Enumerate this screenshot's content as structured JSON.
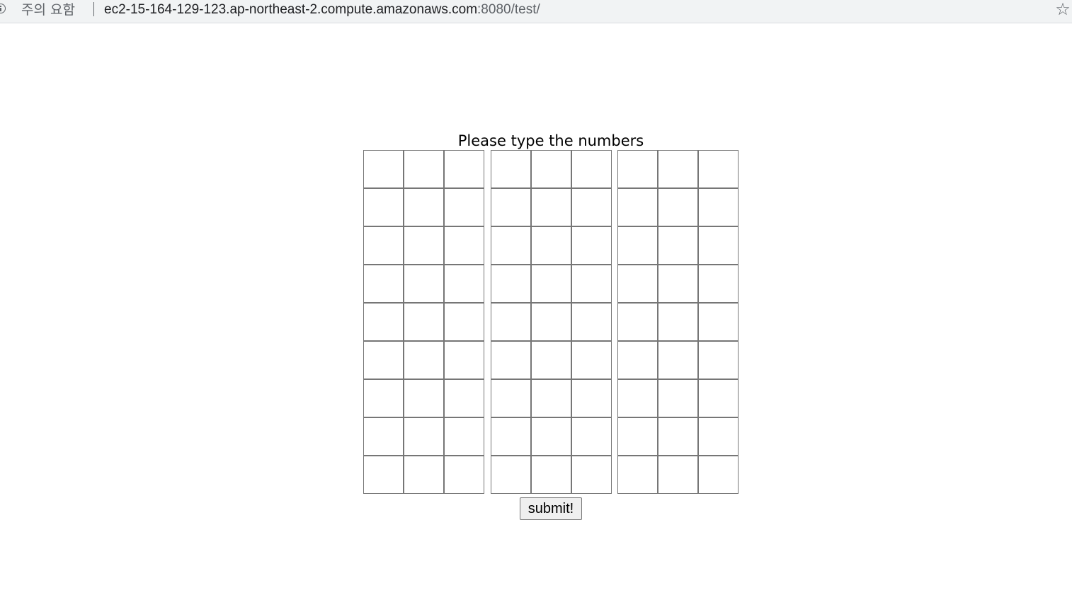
{
  "browser": {
    "security_label": "주의 요함",
    "url_host": "ec2-15-164-129-123.ap-northeast-2.compute.amazonaws.com",
    "url_rest": ":8080/test/",
    "bookmark_icon": "star-icon",
    "info_icon": "info-icon"
  },
  "page": {
    "prompt": "Please type the numbers",
    "submit_label": "submit!",
    "grid": {
      "rows": 9,
      "cols": 9,
      "values": [
        [
          "",
          "",
          "",
          "",
          "",
          "",
          "",
          "",
          ""
        ],
        [
          "",
          "",
          "",
          "",
          "",
          "",
          "",
          "",
          ""
        ],
        [
          "",
          "",
          "",
          "",
          "",
          "",
          "",
          "",
          ""
        ],
        [
          "",
          "",
          "",
          "",
          "",
          "",
          "",
          "",
          ""
        ],
        [
          "",
          "",
          "",
          "",
          "",
          "",
          "",
          "",
          ""
        ],
        [
          "",
          "",
          "",
          "",
          "",
          "",
          "",
          "",
          ""
        ],
        [
          "",
          "",
          "",
          "",
          "",
          "",
          "",
          "",
          ""
        ],
        [
          "",
          "",
          "",
          "",
          "",
          "",
          "",
          "",
          ""
        ],
        [
          "",
          "",
          "",
          "",
          "",
          "",
          "",
          "",
          ""
        ]
      ]
    }
  }
}
